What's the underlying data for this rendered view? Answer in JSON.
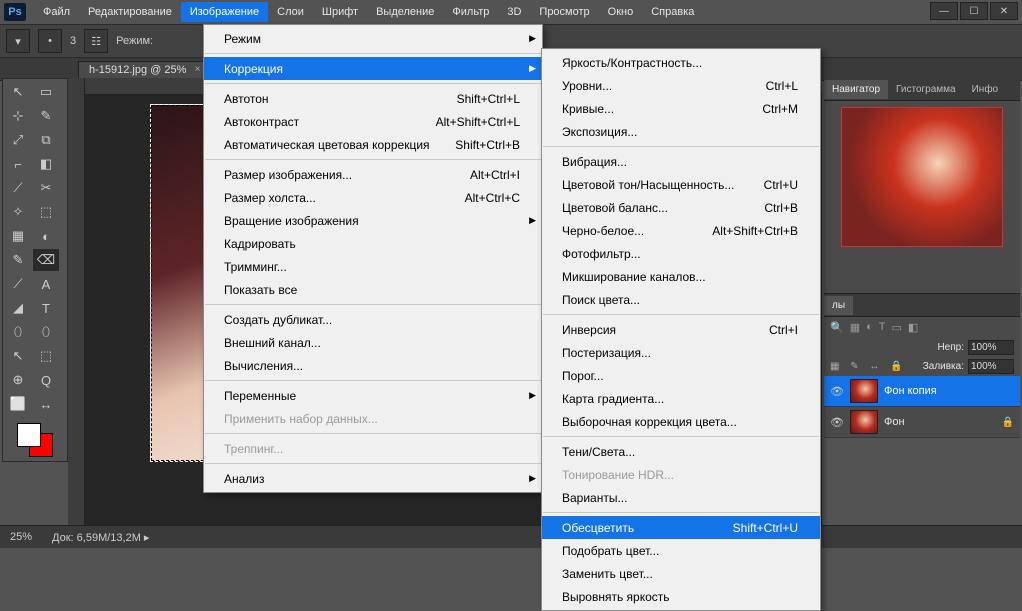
{
  "titlebar": {
    "logo": "Ps",
    "menus": [
      "Файл",
      "Редактирование",
      "Изображение",
      "Слои",
      "Шрифт",
      "Выделение",
      "Фильтр",
      "3D",
      "Просмотр",
      "Окно",
      "Справка"
    ],
    "open_index": 2
  },
  "win_controls": {
    "min": "—",
    "max": "☐",
    "close": "✕"
  },
  "optionbar": {
    "mode_label": "Режим:",
    "brush_size": "3"
  },
  "doc_tab": {
    "label": "h-15912.jpg @ 25%",
    "close": "×"
  },
  "image_menu": {
    "groups": [
      [
        {
          "label": "Режим",
          "arrow": true
        }
      ],
      [
        {
          "label": "Коррекция",
          "arrow": true,
          "hl": true
        }
      ],
      [
        {
          "label": "Автотон",
          "sc": "Shift+Ctrl+L"
        },
        {
          "label": "Автоконтраст",
          "sc": "Alt+Shift+Ctrl+L"
        },
        {
          "label": "Автоматическая цветовая коррекция",
          "sc": "Shift+Ctrl+B"
        }
      ],
      [
        {
          "label": "Размер изображения...",
          "sc": "Alt+Ctrl+I"
        },
        {
          "label": "Размер холста...",
          "sc": "Alt+Ctrl+C"
        },
        {
          "label": "Вращение изображения",
          "arrow": true
        },
        {
          "label": "Кадрировать"
        },
        {
          "label": "Тримминг..."
        },
        {
          "label": "Показать все"
        }
      ],
      [
        {
          "label": "Создать дубликат..."
        },
        {
          "label": "Внешний канал..."
        },
        {
          "label": "Вычисления..."
        }
      ],
      [
        {
          "label": "Переменные",
          "arrow": true
        },
        {
          "label": "Применить набор данных...",
          "dis": true
        }
      ],
      [
        {
          "label": "Треппинг...",
          "dis": true
        }
      ],
      [
        {
          "label": "Анализ",
          "arrow": true
        }
      ]
    ]
  },
  "adjust_menu": {
    "groups": [
      [
        {
          "label": "Яркость/Контрастность..."
        },
        {
          "label": "Уровни...",
          "sc": "Ctrl+L"
        },
        {
          "label": "Кривые...",
          "sc": "Ctrl+M"
        },
        {
          "label": "Экспозиция..."
        }
      ],
      [
        {
          "label": "Вибрация..."
        },
        {
          "label": "Цветовой тон/Насыщенность...",
          "sc": "Ctrl+U"
        },
        {
          "label": "Цветовой баланс...",
          "sc": "Ctrl+B"
        },
        {
          "label": "Черно-белое...",
          "sc": "Alt+Shift+Ctrl+B"
        },
        {
          "label": "Фотофильтр..."
        },
        {
          "label": "Микширование каналов..."
        },
        {
          "label": "Поиск цвета..."
        }
      ],
      [
        {
          "label": "Инверсия",
          "sc": "Ctrl+I"
        },
        {
          "label": "Постеризация..."
        },
        {
          "label": "Порог..."
        },
        {
          "label": "Карта градиента..."
        },
        {
          "label": "Выборочная коррекция цвета..."
        }
      ],
      [
        {
          "label": "Тени/Света..."
        },
        {
          "label": "Тонирование HDR...",
          "dis": true
        },
        {
          "label": "Варианты..."
        }
      ],
      [
        {
          "label": "Обесцветить",
          "sc": "Shift+Ctrl+U",
          "hl": true
        },
        {
          "label": "Подобрать цвет..."
        },
        {
          "label": "Заменить цвет..."
        },
        {
          "label": "Выровнять яркость"
        }
      ]
    ]
  },
  "panels": {
    "nav_tabs": [
      "Навигатор",
      "Гистограмма",
      "Инфо"
    ],
    "layers_tabs_label": "лы",
    "opacity_label": "Непр:",
    "opacity_value": "100%",
    "fill_label": "Заливка:",
    "fill_value": "100%",
    "layers": [
      {
        "name": "Фон копия",
        "sel": true,
        "locked": false
      },
      {
        "name": "Фон",
        "sel": false,
        "locked": true
      }
    ]
  },
  "statusbar": {
    "zoom": "25%",
    "doc_label": "Док:",
    "doc_value": "6,59M/13,2M"
  },
  "tools": [
    "↖",
    "▭",
    "⊹",
    "✎",
    "⤢",
    "⧉",
    "⌐",
    "◧",
    "⟋",
    "✂",
    "✧",
    "⬚",
    "▦",
    "◐",
    "✎",
    "⌫",
    "⟋",
    "A",
    "◢",
    "T",
    "⬯",
    "⬯",
    "↖",
    "⬚",
    "⊕",
    "Q",
    "⬜",
    "↔"
  ]
}
